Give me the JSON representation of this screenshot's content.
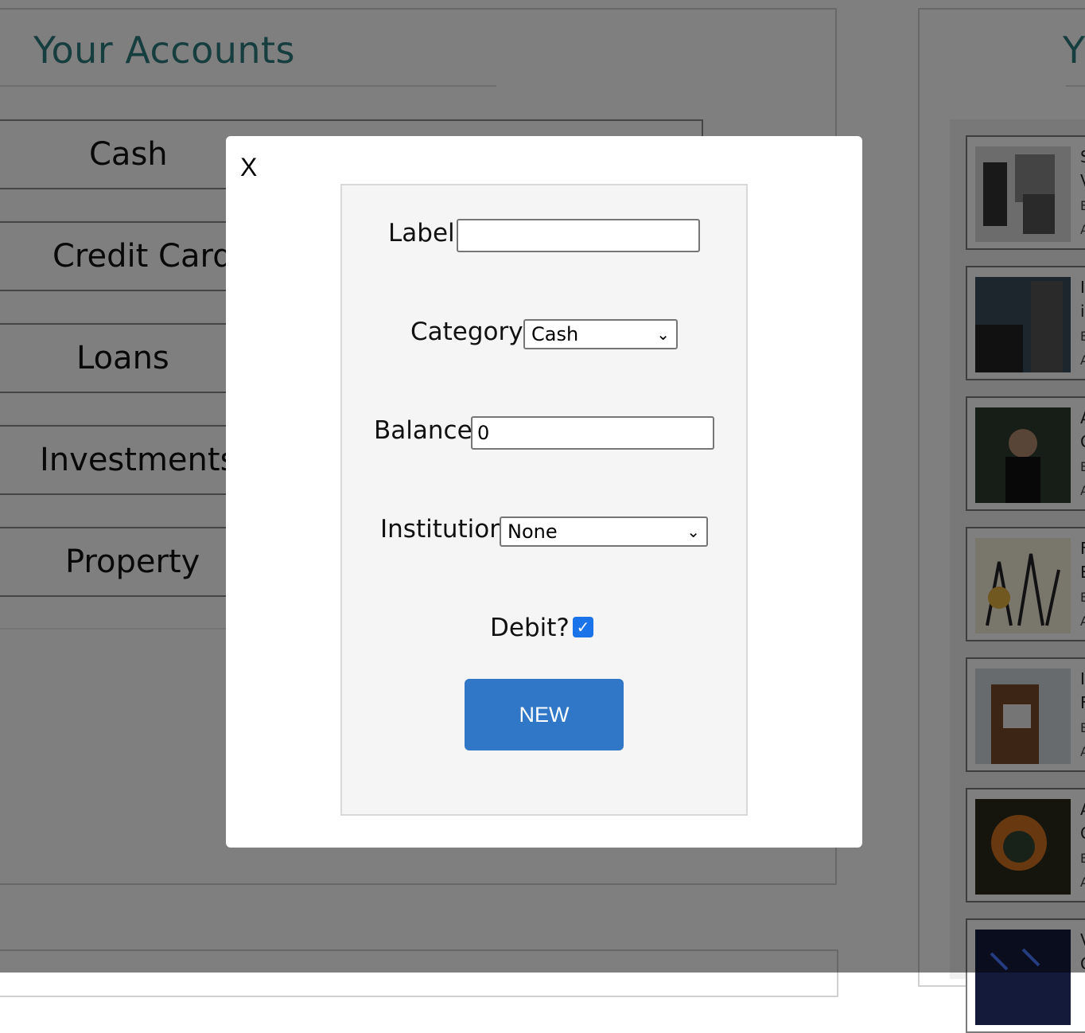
{
  "accounts": {
    "title": "Your Accounts",
    "categories": [
      "Cash",
      "Credit Cards",
      "Loans",
      "Investments",
      "Property"
    ]
  },
  "right_panel": {
    "title_fragment": "Y",
    "cards": [
      {
        "line1": "S",
        "line2": "V",
        "line3": "E",
        "line4": "A"
      },
      {
        "line1": "I",
        "line2": "i",
        "line3": "E",
        "line4": "A"
      },
      {
        "line1": "A",
        "line2": "C",
        "line3": "E",
        "line4": "A"
      },
      {
        "line1": "F",
        "line2": "E",
        "line3": "E",
        "line4": "A"
      },
      {
        "line1": "I",
        "line2": "F",
        "line3": "E",
        "line4": "A"
      },
      {
        "line1": "A",
        "line2": "C",
        "line3": "E",
        "line4": "A"
      },
      {
        "line1": "V",
        "line2": "C",
        "line3": "",
        "line4": ""
      }
    ]
  },
  "modal": {
    "close_label": "X",
    "form": {
      "label_field": {
        "label": "Label:",
        "value": ""
      },
      "category_field": {
        "label": "Category:",
        "selected": "Cash"
      },
      "balance_field": {
        "label": "Balance:",
        "value": "0"
      },
      "institution_field": {
        "label": "Institution:",
        "selected": "None"
      },
      "debit_field": {
        "label": "Debit?",
        "checked": true
      },
      "submit_label": "NEW"
    }
  },
  "colors": {
    "title_teal": "#2f7c7e",
    "button_blue": "#3177c8",
    "checkbox_blue": "#1a73e8"
  }
}
